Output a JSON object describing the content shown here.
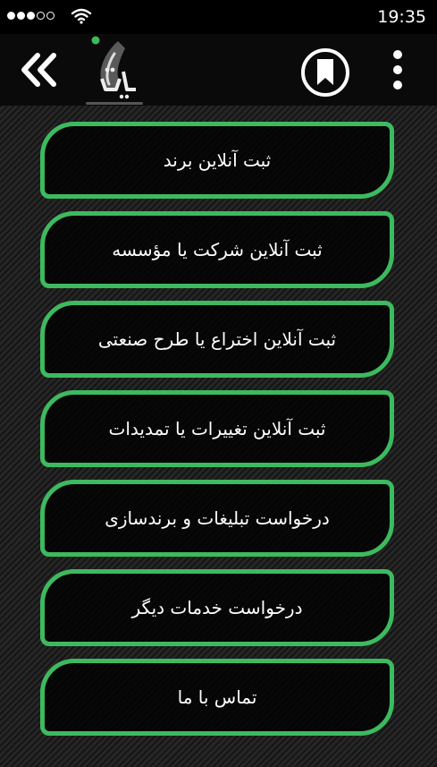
{
  "status_bar": {
    "time": "19:35",
    "signal": {
      "filled": 3,
      "total": 5
    }
  },
  "header": {
    "back_icon": "double-chevron-left-icon",
    "bookmark_icon": "bookmark-icon",
    "menu_icon": "more-vert-icon"
  },
  "menu": {
    "items": [
      {
        "label": "ثبت آنلاین برند"
      },
      {
        "label": "ثبت آنلاین شرکت یا مؤسسه"
      },
      {
        "label": "ثبت آنلاین اختراع یا طرح صنعتی"
      },
      {
        "label": "ثبت آنلاین تغییرات یا تمدیدات"
      },
      {
        "label": "درخواست تبلیغات و برندسازی"
      },
      {
        "label": "درخواست خدمات دیگر"
      },
      {
        "label": "تماس با ما"
      }
    ]
  },
  "colors": {
    "accent_green": "#3dba5f",
    "background": "#1f1f1f"
  }
}
